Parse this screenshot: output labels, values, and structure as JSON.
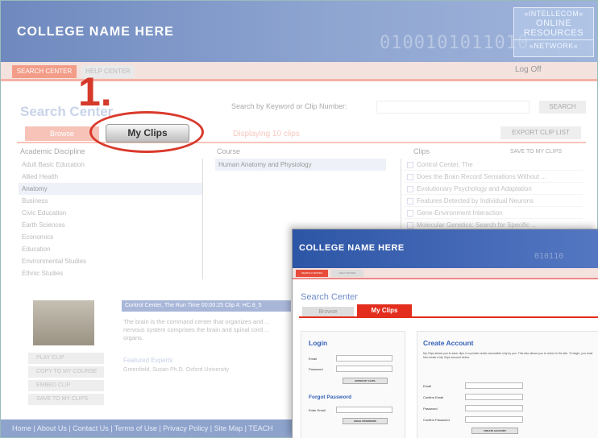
{
  "header": {
    "title": "COLLEGE NAME HERE",
    "binary": "0100101011010",
    "logo": {
      "line1": "»INTELLECOM«",
      "line2": "ONLINE",
      "line3": "RESOURCES",
      "line4": "»NETWORK«"
    }
  },
  "nav": {
    "tab1": "SEARCH CENTER",
    "tab2": "HELP CENTER",
    "logoff": "Log Off"
  },
  "step_number": "1.",
  "search": {
    "title": "Search Center",
    "label": "Search by Keyword or Clip Number:",
    "button": "SEARCH"
  },
  "tabs": {
    "browse": "Browse",
    "myclips": "My Clips"
  },
  "displaying": "Displaying 10 clips",
  "export_button": "EXPORT CLIP LIST",
  "columns": {
    "discipline": "Academic Discipline",
    "course": "Course",
    "clips": "Clips",
    "save": "SAVE TO MY CLIPS"
  },
  "disciplines": [
    "Adult Basic Education",
    "Allied Health",
    "Anatomy",
    "Business",
    "Civic Education",
    "Earth Sciences",
    "Economics",
    "Education",
    "Environmental Studies",
    "Ethnic Studies"
  ],
  "courses": [
    "Human Anatomy and Physiology"
  ],
  "clips": [
    "Control Center, The",
    "Does the Brain Record Sensations Without ...",
    "Evolutionary Psychology and Adaptation",
    "Features Detected by Individual Neurons",
    "Gene-Environment Interaction",
    "Molecular Genetics: Search for Specific ..."
  ],
  "detail": {
    "bar": "Control Center, The    Run Time 00:00:25    Clip #: HC.8_5",
    "description": "The brain is the command center that organizes and ... nervous system comprises the brain and spinal cord ... organs.",
    "related_title": "Featured Experts",
    "related_name": "Greenfield, Susan Ph.D. Oxford University"
  },
  "actions": [
    "PLAY CLIP",
    "COPY TO MY COURSE",
    "EMBED CLIP",
    "SAVE TO MY CLIPS"
  ],
  "footer": "Home  |  About Us  |  Contact Us  |  Terms of Use  |  Privacy Policy  |  Site Map  |  TEACH",
  "panel": {
    "title": "COLLEGE NAME HERE",
    "binary": "010110",
    "nav1": "SEARCH CENTER",
    "nav2": "HELP CENTER",
    "search_title": "Search Center",
    "browse": "Browse",
    "myclips": "My Clips",
    "login": {
      "heading": "Login",
      "email_label": "Email",
      "password_label": "Password",
      "button": "ENTER MY CLIPS"
    },
    "forgot": {
      "heading": "Forgot Password",
      "email_label": "Enter Email",
      "button": "EMAIL PASSWORD"
    },
    "create": {
      "heading": "Create Account",
      "intro": "My Clips allows you to save clips in a private center accessible only by you. This also allows you to return to the site. To begin, you must first create a My Clips account below.",
      "email_label": "Email",
      "confirm_email_label": "Confirm Email",
      "password_label": "Password",
      "confirm_password_label": "Confirm Password",
      "button": "CREATE ACCOUNT"
    }
  }
}
